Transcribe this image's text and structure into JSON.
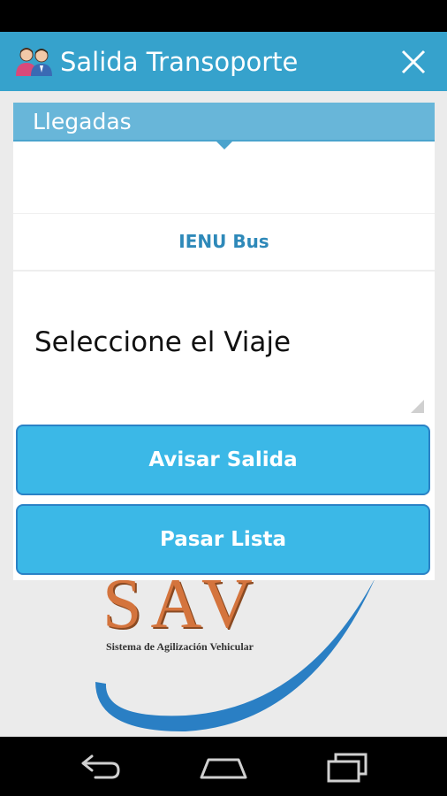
{
  "app": {
    "title": "Salida Transoporte",
    "accent_color": "#36a2cc"
  },
  "section": {
    "title": "Llegadas"
  },
  "bus": {
    "label": "IENU Bus"
  },
  "trip": {
    "placeholder": "Seleccione el Viaje"
  },
  "buttons": {
    "notify_label": "Avisar Salida",
    "roll_call_label": "Pasar Lista"
  },
  "logo": {
    "text": "SAV",
    "subtitle": "Sistema de Agilización Vehicular"
  },
  "icons": {
    "app": "users-icon",
    "close": "close-icon",
    "back": "back-icon",
    "home": "home-icon",
    "recent": "recent-apps-icon"
  }
}
